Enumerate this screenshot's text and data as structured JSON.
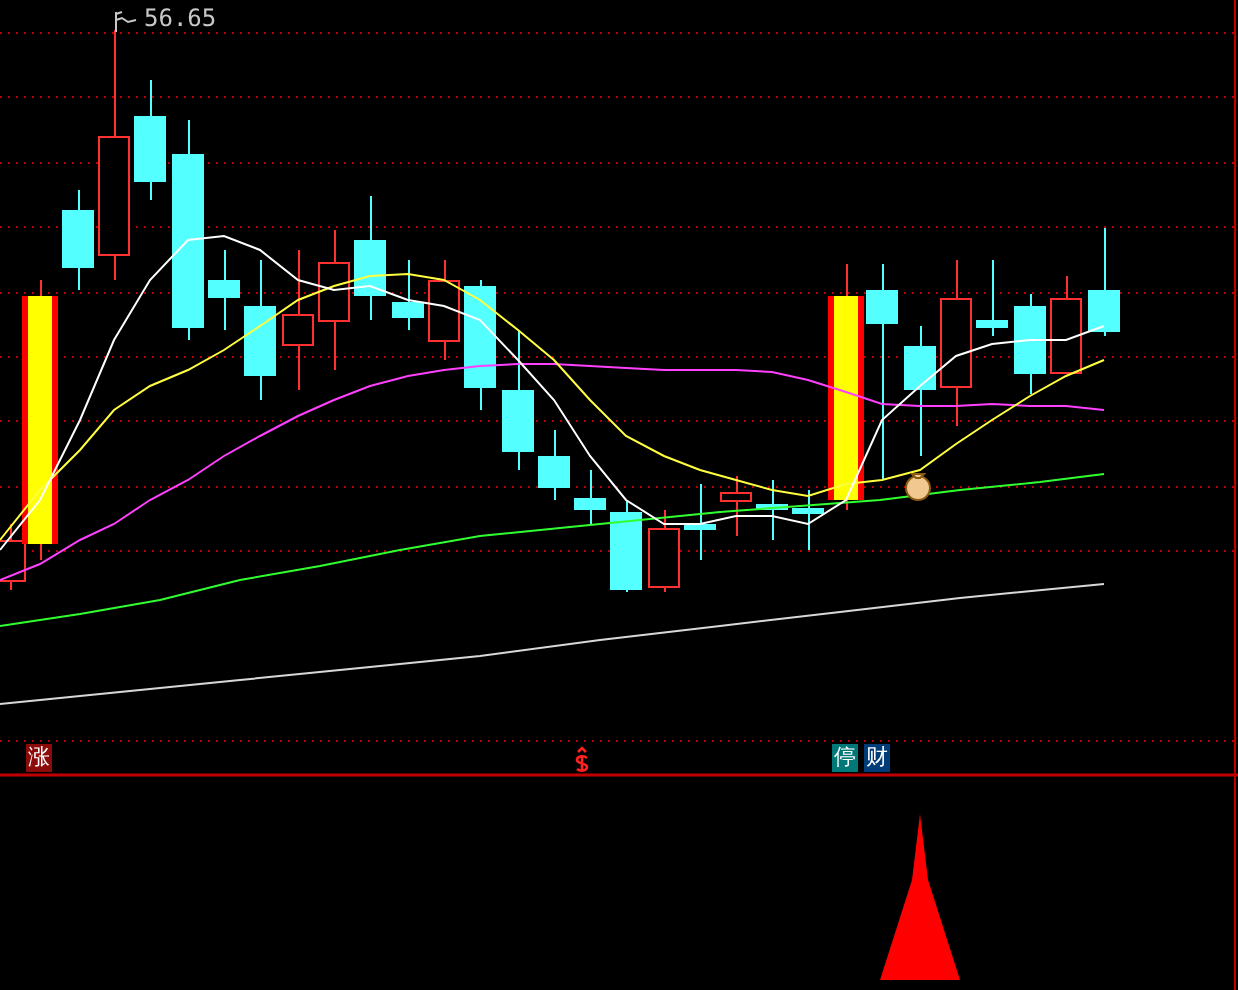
{
  "price_chart": {
    "high_label": "56.65"
  },
  "signal_markers": [
    {
      "kind": "badge",
      "label": "涨",
      "color": "#8b0a0a"
    },
    {
      "kind": "dollar",
      "color": "#ff2020"
    },
    {
      "kind": "badge",
      "label": "停",
      "color": "#007878"
    },
    {
      "kind": "badge",
      "label": "财",
      "color": "#003c78"
    }
  ]
}
